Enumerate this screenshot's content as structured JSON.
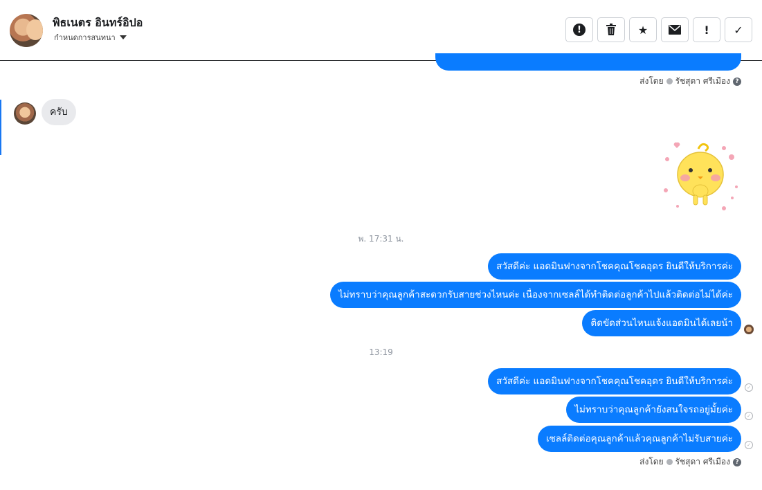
{
  "header": {
    "contact_name": "พิธเนตร อินทร์อิปอ",
    "subtitle": "กำหนดการสนทนา",
    "toolbar": [
      {
        "icon": "report-circle-icon",
        "label": "!"
      },
      {
        "icon": "trash-icon",
        "label": "🗑"
      },
      {
        "icon": "star-icon",
        "label": "★"
      },
      {
        "icon": "envelope-icon",
        "label": "✉"
      },
      {
        "icon": "exclamation-icon",
        "label": "!"
      },
      {
        "icon": "check-icon",
        "label": "✓"
      }
    ]
  },
  "chat": {
    "sent_by_1": {
      "prefix": "ส่งโดย",
      "name": "รัชสุดา ศรีเมือง"
    },
    "incoming": "ครับ",
    "timestamp_1": "พ. 17:31 น.",
    "group1": [
      "สวัสดีค่ะ แอดมินฟางจากโชคคุณโชคอุดร ยินดีให้บริการค่ะ",
      "ไม่ทราบว่าคุณลูกค้าสะดวกรับสายช่วงไหนค่ะ เนื่องจากเซลล์ได้ทำติดต่อลูกค้าไปแล้วติดต่อไม่ได้ค่ะ",
      "ติดขัดส่วนไหนแจ้งแอดมินได้เลยน้า"
    ],
    "timestamp_2": "13:19",
    "group2": [
      "สวัสดีค่ะ แอดมินฟางจากโชคคุณโชคอุดร ยินดีให้บริการค่ะ",
      "ไม่ทราบว่าคุณลูกค้ายังสนใจรถอยู่มั้ยค่ะ",
      "เซลล์ติดต่อคุณลูกค้าแล้วคุณลูกค้าไม่รับสายค่ะ"
    ],
    "sent_by_2": {
      "prefix": "ส่งโดย",
      "name": "รัชสุดา ศรีเมือง"
    }
  },
  "colors": {
    "bubble_out": "#0a7cff",
    "bubble_in": "#e9eaed",
    "accent": "#1877f2"
  }
}
